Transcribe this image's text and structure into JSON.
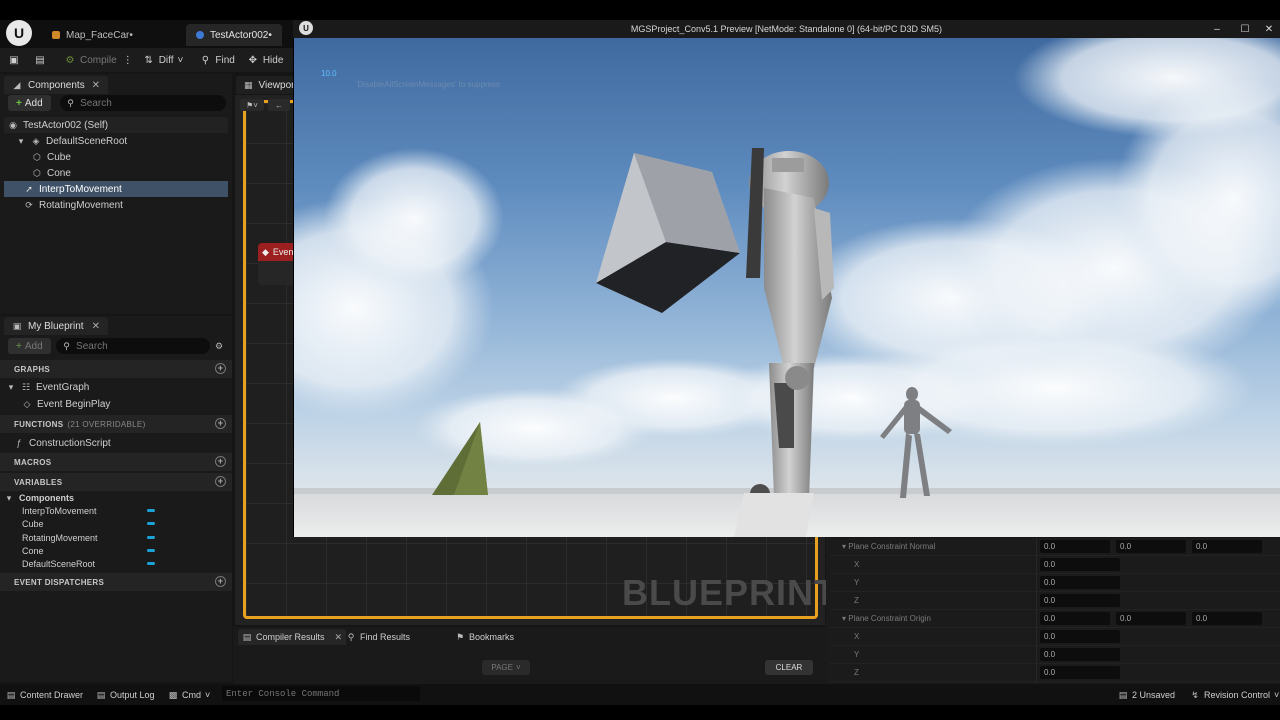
{
  "app": {
    "logo": "U",
    "tabs": [
      {
        "label": "Map_FaceCar•",
        "active": false,
        "icon": "map-icon"
      },
      {
        "label": "TestActor002•",
        "active": true,
        "icon": "blueprint-icon"
      }
    ]
  },
  "toolbar": {
    "save_icon": "save-icon",
    "browse_icon": "browse-icon",
    "compile_label": "Compile",
    "diff_label": "Diff",
    "find_label": "Find",
    "hide_label": "Hide"
  },
  "components_panel": {
    "tab_label": "Components",
    "add_label": "Add",
    "search_placeholder": "Search",
    "tree": [
      {
        "label": "TestActor002 (Self)",
        "level": 0,
        "selected": false
      },
      {
        "label": "DefaultSceneRoot",
        "level": 1,
        "selected": false
      },
      {
        "label": "Cube",
        "level": 2,
        "selected": false
      },
      {
        "label": "Cone",
        "level": 2,
        "selected": false
      },
      {
        "label": "InterpToMovement",
        "level": 1,
        "selected": true
      },
      {
        "label": "RotatingMovement",
        "level": 1,
        "selected": false
      }
    ]
  },
  "viewport_tab": {
    "label": "Viewport"
  },
  "my_blueprint": {
    "tab_label": "My Blueprint",
    "add_label": "Add",
    "search_placeholder": "Search",
    "sections": {
      "graphs": "GRAPHS",
      "functions": "FUNCTIONS",
      "functions_count": "(21 OVERRIDABLE)",
      "macros": "MACROS",
      "variables": "VARIABLES",
      "event_dispatchers": "EVENT DISPATCHERS"
    },
    "event_graph": "EventGraph",
    "event_begin_play": "Event BeginPlay",
    "construction_script": "ConstructionScript",
    "components_group": "Components",
    "variables": [
      "InterpToMovement",
      "Cube",
      "RotatingMovement",
      "Cone",
      "DefaultSceneRoot"
    ]
  },
  "graph": {
    "watermark": "BLUEPRINT",
    "event_node_label": "Even"
  },
  "bottom_tabs": {
    "compiler_results": "Compiler Results",
    "find_results": "Find Results",
    "bookmarks": "Bookmarks",
    "page_label": "PAGE",
    "clear_label": "CLEAR"
  },
  "status_bar": {
    "content_drawer": "Content Drawer",
    "output_log": "Output Log",
    "cmd": "Cmd",
    "console_placeholder": "Enter Console Command",
    "unsaved": "2 Unsaved",
    "revision_control": "Revision Control"
  },
  "details": {
    "plane_normal_label": "Plane Constraint Normal",
    "plane_origin_label": "Plane Constraint Origin",
    "axis_x": "X",
    "axis_y": "Y",
    "axis_z": "Z",
    "value": "0.0"
  },
  "preview": {
    "title": "MGSProject_Conv5.1 Preview [NetMode: Standalone 0]  (64-bit/PC D3D SM5)",
    "fps": "10.0",
    "faint_message": "'DisableAllScreenMessages' to suppress",
    "minimize": "–",
    "maximize": "☐",
    "close": "✕"
  },
  "colors": {
    "accent_orange": "#e8a020",
    "selection": "#3f5166",
    "event_red": "#9b1f1f",
    "sky_top": "#3f6aa0",
    "ground": "#e4e4e4"
  }
}
